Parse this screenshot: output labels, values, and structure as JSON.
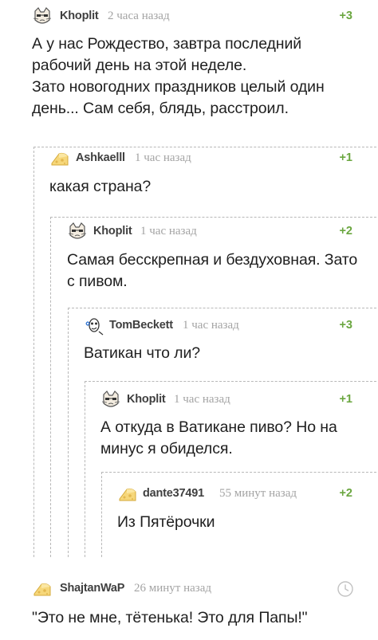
{
  "comments": [
    {
      "author": "Khoplit",
      "time": "2 часа назад",
      "rating": "+3",
      "text": "А у нас Рождество, завтра последний рабочий день на этой неделе.\nЗато новогодних праздников целый один день... Сам себя, блядь, расстроил."
    },
    {
      "author": "Ashkaelll",
      "time": "1 час назад",
      "rating": "+1",
      "text": "какая страна?"
    },
    {
      "author": "Khoplit",
      "time": "1 час назад",
      "rating": "+2",
      "text": "Самая бесскрепная и бездуховная. Зато с пивом."
    },
    {
      "author": "TomBeckett",
      "time": "1 час назад",
      "rating": "+3",
      "text": "Ватикан что ли?"
    },
    {
      "author": "Khoplit",
      "time": "1 час назад",
      "rating": "+1",
      "text": "А откуда в Ватикане пиво? Но на минус я обиделся."
    },
    {
      "author": "dante37491",
      "time": "55 минут назад",
      "rating": "+2",
      "text": "Из Пятёрочки"
    },
    {
      "author": "ShajtanWaP",
      "time": "26 минут назад",
      "rating": "",
      "text": "\"Это не мне, тётенька! Это для Папы!\""
    }
  ],
  "colors": {
    "rating": "#6aa63f",
    "author": "#3f3f3f",
    "time": "#a3a3a3",
    "branch": "#b8b8b8"
  },
  "icons": {
    "pending_rating": "clock-icon"
  }
}
